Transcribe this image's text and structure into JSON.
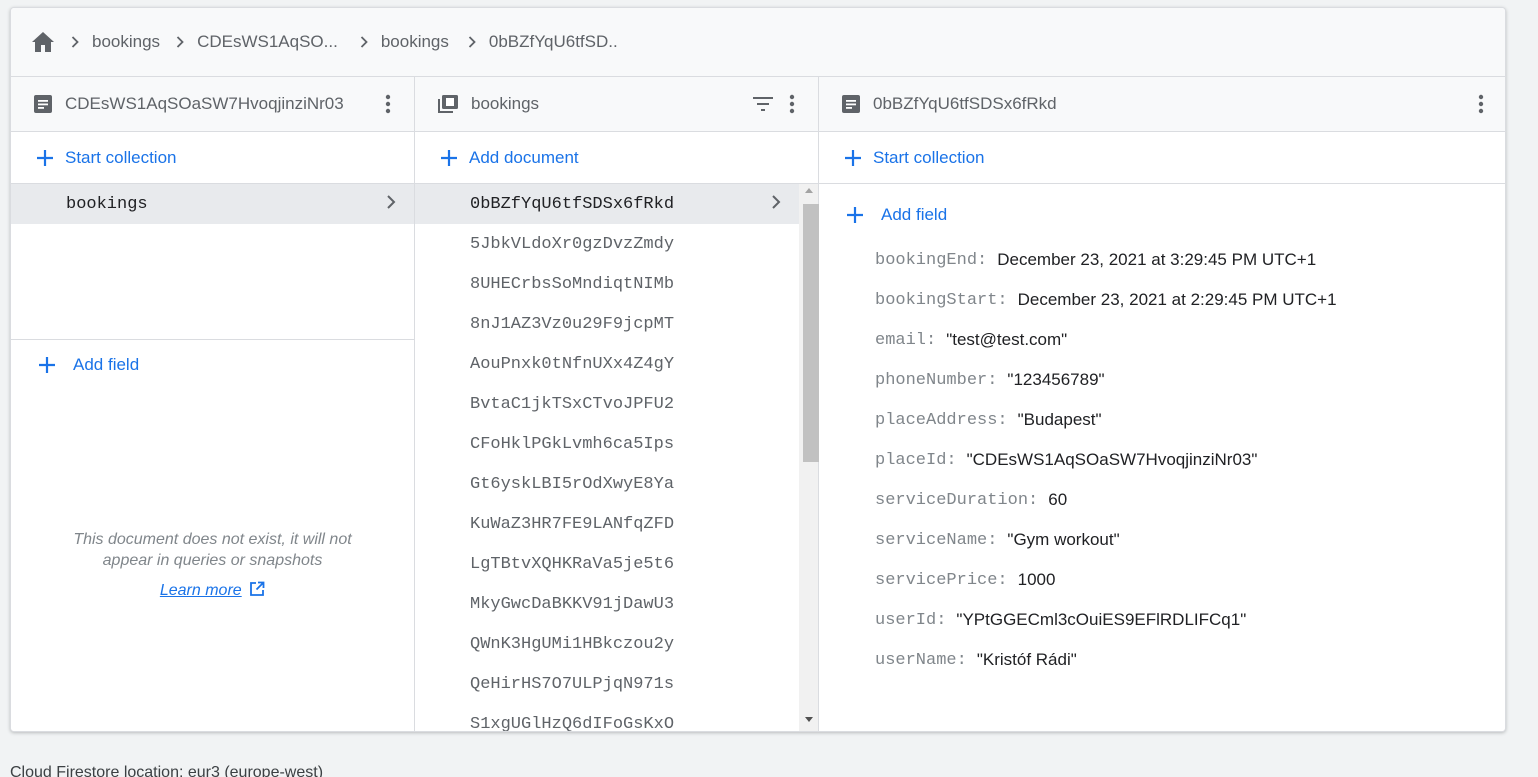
{
  "breadcrumbs": [
    "bookings",
    "CDEsWS1AqSO...",
    "bookings",
    "0bBZfYqU6tfSD.."
  ],
  "col1": {
    "title": "CDEsWS1AqSOaSW7HvoqjinziNr03",
    "start_collection": "Start collection",
    "items": [
      "bookings"
    ],
    "add_field": "Add field",
    "empty_note_line1": "This document does not exist, it will not",
    "empty_note_line2": "appear in queries or snapshots",
    "learn_more": "Learn more"
  },
  "col2": {
    "title": "bookings",
    "add_document": "Add document",
    "documents": [
      "0bBZfYqU6tfSDSx6fRkd",
      "5JbkVLdoXr0gzDvzZmdy",
      "8UHECrbsSoMndiqtNIMb",
      "8nJ1AZ3Vz0u29F9jcpMT",
      "AouPnxk0tNfnUXx4Z4gY",
      "BvtaC1jkTSxCTvoJPFU2",
      "CFoHklPGkLvmh6ca5Ips",
      "Gt6yskLBI5rOdXwyE8Ya",
      "KuWaZ3HR7FE9LANfqZFD",
      "LgTBtvXQHKRaVa5je5t6",
      "MkyGwcDaBKKV91jDawU3",
      "QWnK3HgUMi1HBkczou2y",
      "QeHirHS7O7ULPjqN971s",
      "S1xgUGlHzQ6dIFoGsKxO"
    ]
  },
  "col3": {
    "title": "0bBZfYqU6tfSDSx6fRkd",
    "start_collection": "Start collection",
    "add_field": "Add field",
    "fields": [
      {
        "key": "bookingEnd:",
        "value": "December 23, 2021 at 3:29:45 PM UTC+1"
      },
      {
        "key": "bookingStart:",
        "value": "December 23, 2021 at 2:29:45 PM UTC+1"
      },
      {
        "key": "email:",
        "value": "\"test@test.com\""
      },
      {
        "key": "phoneNumber:",
        "value": "\"123456789\""
      },
      {
        "key": "placeAddress:",
        "value": "\"Budapest\""
      },
      {
        "key": "placeId:",
        "value": "\"CDEsWS1AqSOaSW7HvoqjinziNr03\""
      },
      {
        "key": "serviceDuration:",
        "value": "60"
      },
      {
        "key": "serviceName:",
        "value": "\"Gym workout\""
      },
      {
        "key": "servicePrice:",
        "value": "1000"
      },
      {
        "key": "userId:",
        "value": "\"YPtGGECml3cOuiES9EFlRDLIFCq1\""
      },
      {
        "key": "userName:",
        "value": "\"Kristóf Rádi\""
      }
    ]
  },
  "footer": "Cloud Firestore location: eur3 (europe-west)",
  "colors": {
    "accent": "#1a73e8",
    "muted": "#5f6368",
    "selected_bg": "#e8eaed"
  }
}
